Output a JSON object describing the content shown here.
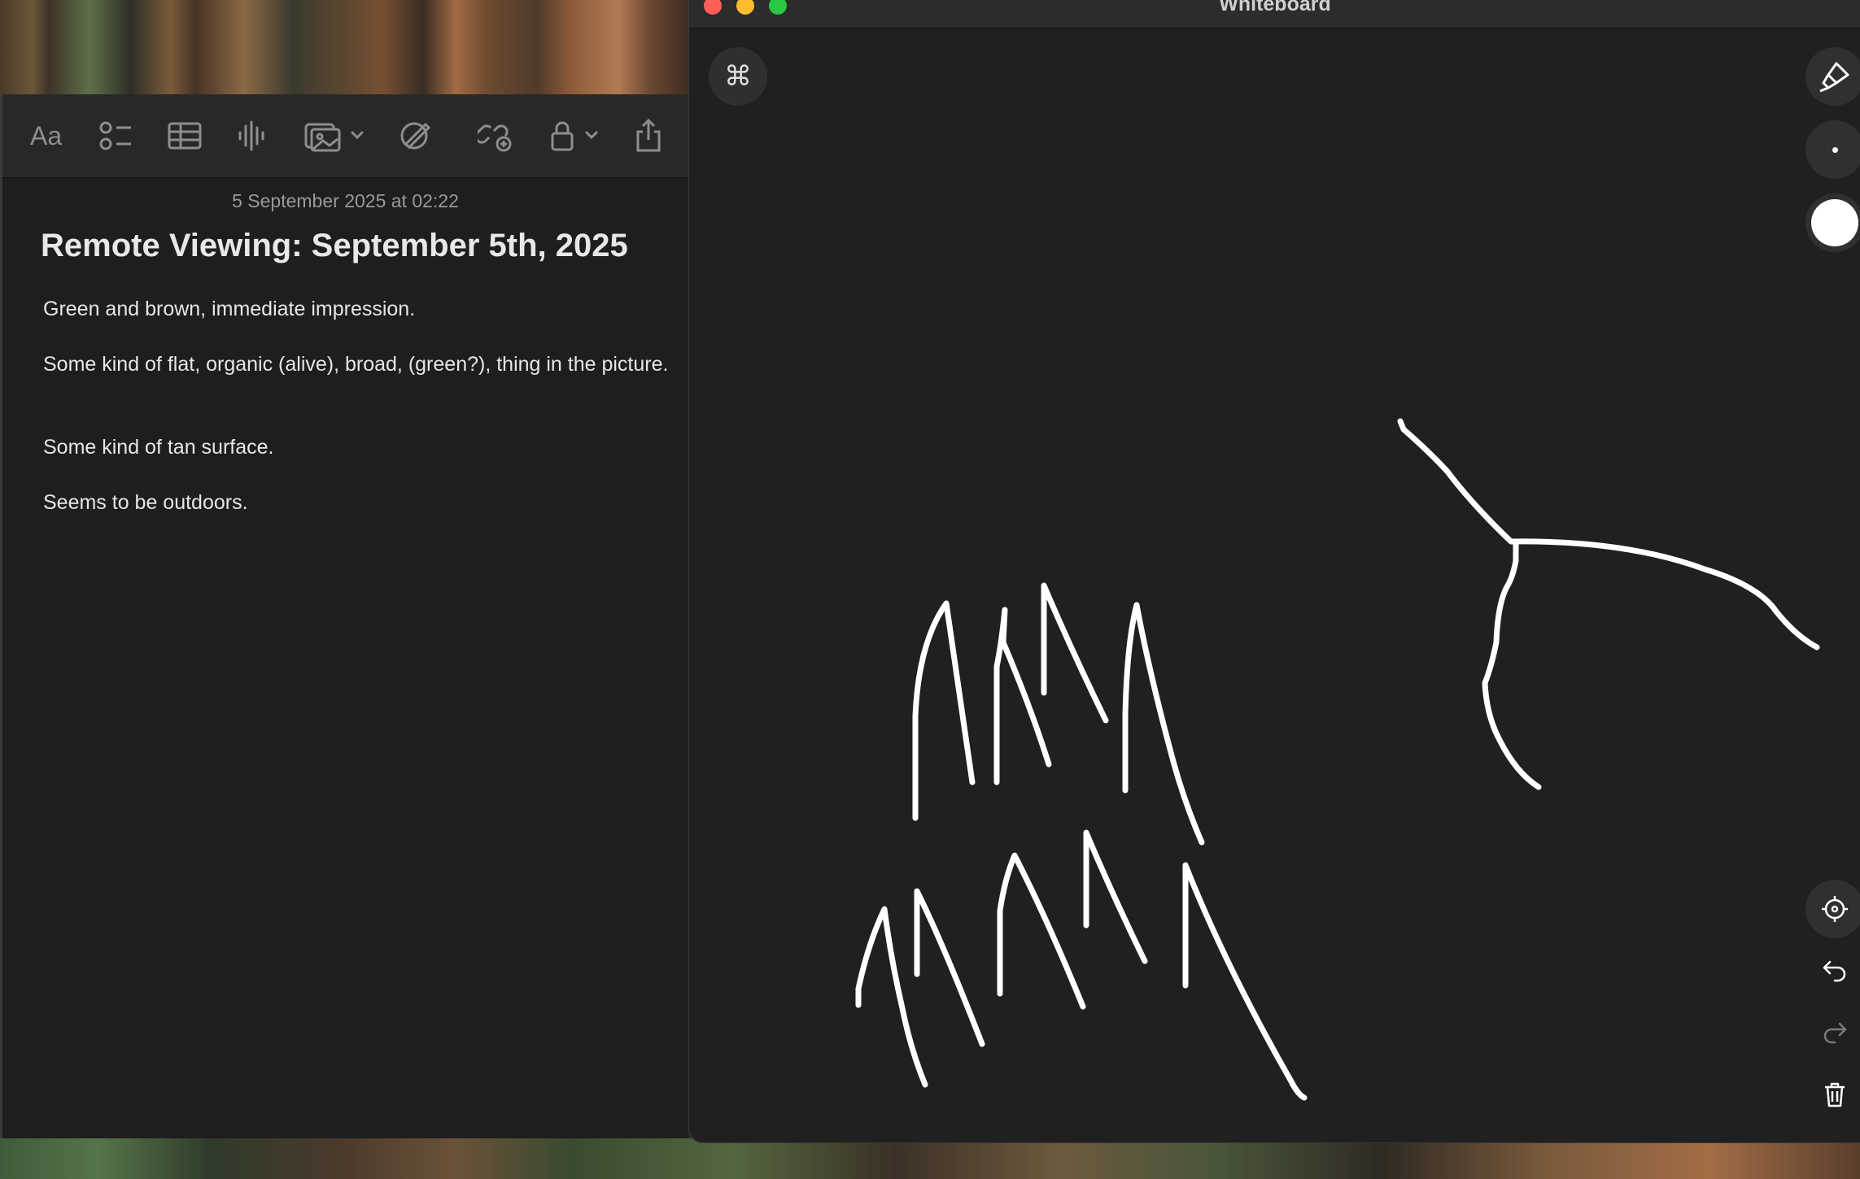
{
  "notes": {
    "date": "5 September 2025 at 02:22",
    "title": "Remote Viewing: September 5th, 2025",
    "paragraphs": [
      "Green and brown, immediate impression.",
      "Some kind of flat, organic (alive), broad, (green?), thing in the picture.",
      "Some kind of tan surface.",
      "Seems to be outdoors."
    ],
    "toolbar": {
      "format_label": "Aa",
      "icons": [
        "checklist-icon",
        "table-icon",
        "audio-icon",
        "media-icon",
        "markup-icon",
        "collaborate-icon",
        "lock-icon",
        "share-icon"
      ]
    }
  },
  "whiteboard": {
    "window_title": "Whiteboard",
    "command_label": "⌘",
    "stroke_color": "#ffffff",
    "background_color": "#202020",
    "tools": [
      "highlighter-icon",
      "brush-size-icon",
      "color-swatch-icon",
      "recenter-icon",
      "undo-icon",
      "redo-icon",
      "trash-icon"
    ]
  },
  "colors": {
    "close": "#ff5f57",
    "minimize": "#febc2e",
    "zoom": "#28c840"
  }
}
